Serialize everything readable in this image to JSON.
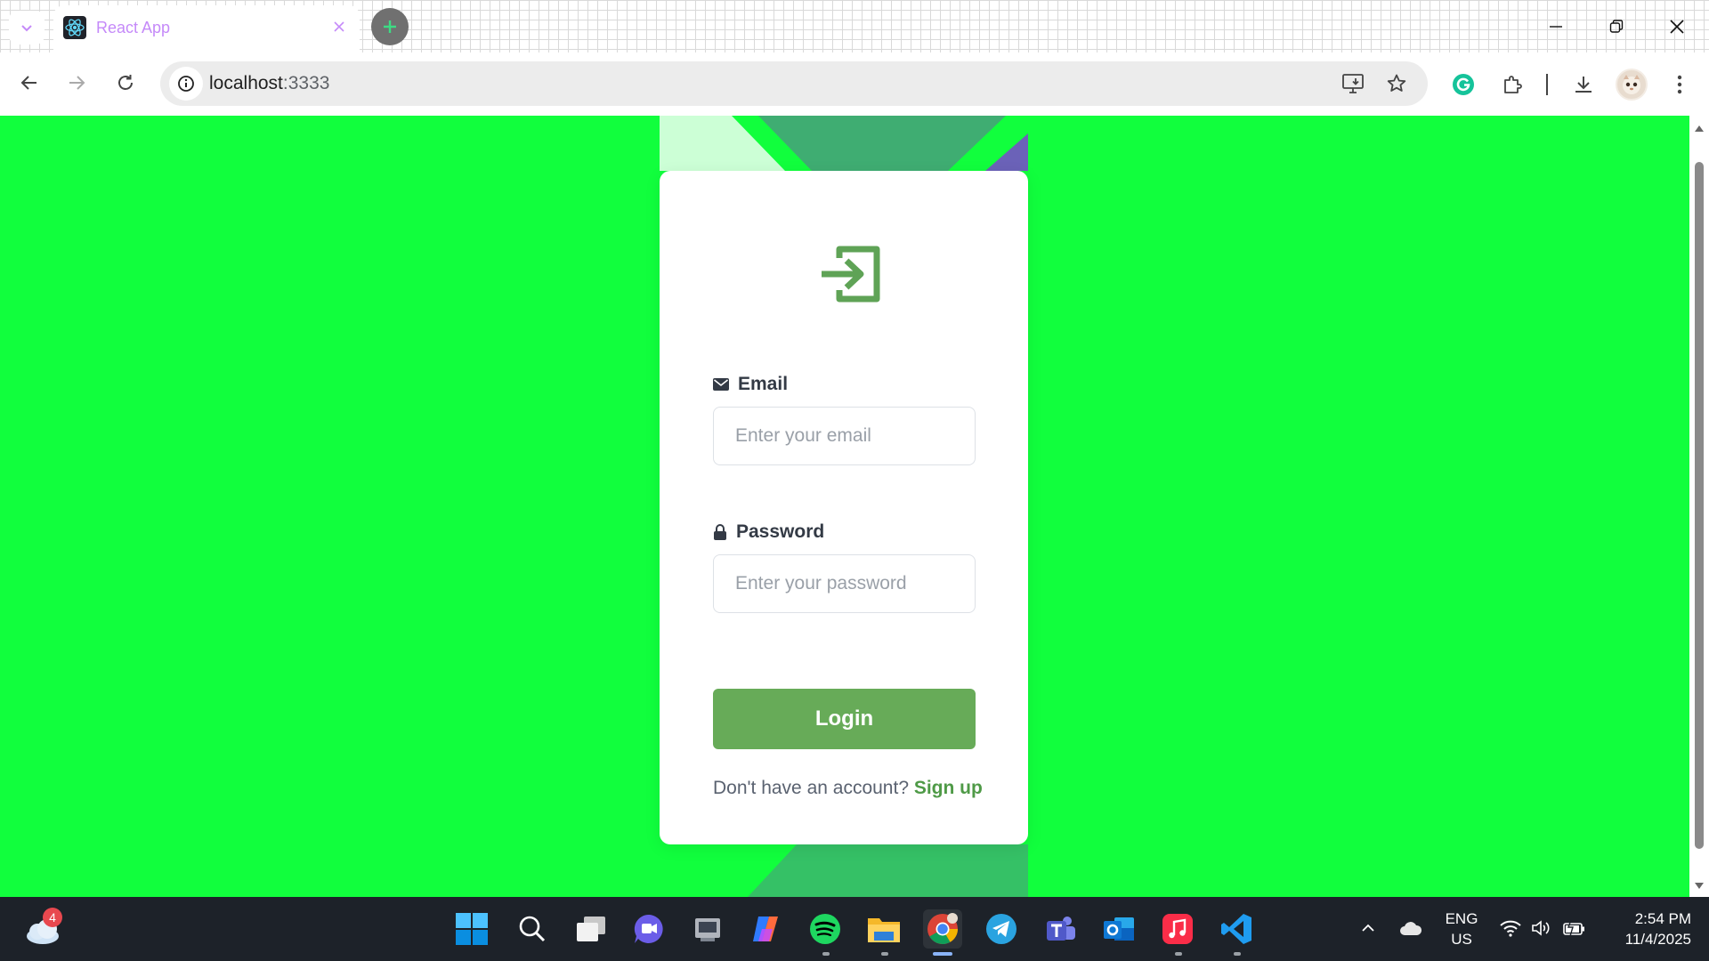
{
  "browser": {
    "tab_title": "React App",
    "url_host": "localhost",
    "url_port": ":3333"
  },
  "login": {
    "email_label": "Email",
    "email_placeholder": "Enter your email",
    "password_label": "Password",
    "password_placeholder": "Enter your password",
    "login_button": "Login",
    "signup_prompt": "Don't have an account?",
    "signup_link": "Sign up"
  },
  "taskbar": {
    "weather_badge": "4",
    "language": "ENG",
    "region": "US",
    "time": "2:54 PM",
    "date": "11/4/2025",
    "apps": [
      "start-icon",
      "search-icon",
      "task-view-icon",
      "chat-icon",
      "app-icon",
      "copilot-icon",
      "spotify-icon",
      "file-explorer-icon",
      "chrome-icon",
      "telegram-icon",
      "teams-icon",
      "outlook-icon",
      "music-icon",
      "vscode-icon"
    ]
  },
  "colors": {
    "page_background": "#11ff3d",
    "accent": "#67ab58",
    "link": "#4f9a47",
    "tab_title": "#c58af9"
  }
}
